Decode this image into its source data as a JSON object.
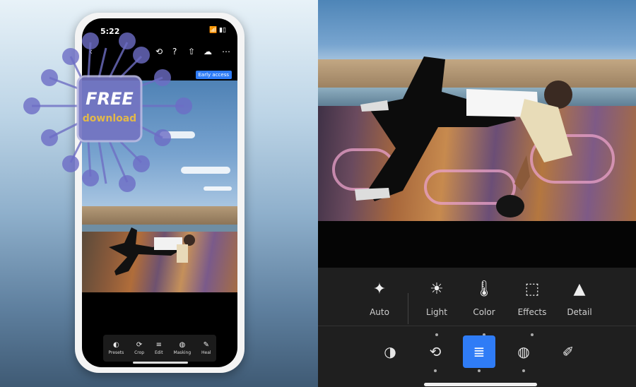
{
  "left": {
    "status": {
      "time": "5:22",
      "icons": "📶 ▮▯"
    },
    "top_icons": {
      "back": "chevron-left-icon",
      "history": "history-icon",
      "help": "help-icon",
      "share": "share-icon",
      "cloud": "cloud-icon",
      "more": "more-icon"
    },
    "early_access": "Early access",
    "watermark": {
      "line1": "FREE",
      "line2": "download"
    },
    "toolbar": [
      {
        "label": "Presets",
        "glyph": "◐"
      },
      {
        "label": "Crop",
        "glyph": "⟳"
      },
      {
        "label": "Edit",
        "glyph": "≡"
      },
      {
        "label": "Masking",
        "glyph": "◍"
      },
      {
        "label": "Heal",
        "glyph": "✎"
      }
    ]
  },
  "right": {
    "tools": [
      {
        "label": "Auto",
        "glyph": "✦"
      },
      {
        "label": "Light",
        "glyph": "☀"
      },
      {
        "label": "Color",
        "glyph": "🌡"
      },
      {
        "label": "Effects",
        "glyph": "⬚"
      },
      {
        "label": "Detail",
        "glyph": "▲"
      }
    ],
    "bottom_tools": [
      {
        "name": "presets",
        "glyph": "◑"
      },
      {
        "name": "crop",
        "glyph": "⟲"
      },
      {
        "name": "edit",
        "glyph": "≣"
      },
      {
        "name": "masking",
        "glyph": "◍"
      },
      {
        "name": "heal",
        "glyph": "✐"
      }
    ],
    "accent": "#2f7cf6"
  }
}
